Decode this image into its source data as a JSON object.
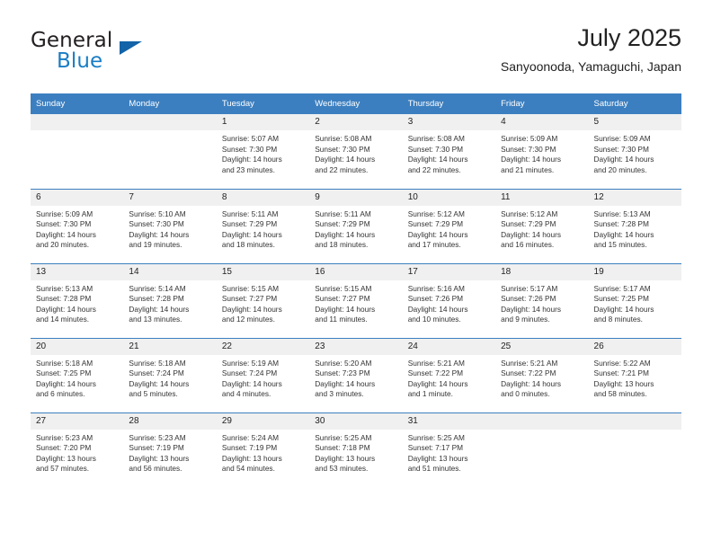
{
  "brand": {
    "name_top": "General",
    "name_bottom": "Blue",
    "accent_color": "#1263a8",
    "text_color": "#231f20",
    "blue_text_color": "#1a7dc4"
  },
  "header": {
    "title": "July 2025",
    "subtitle": "Sanyoonoda, Yamaguchi, Japan"
  },
  "theme": {
    "header_bg": "#3c7fc0",
    "header_text": "#ffffff",
    "daynum_bg": "#f0f0f0",
    "body_text": "#333333"
  },
  "weekdays": [
    "Sunday",
    "Monday",
    "Tuesday",
    "Wednesday",
    "Thursday",
    "Friday",
    "Saturday"
  ],
  "weeks": [
    [
      {
        "day": "",
        "sunrise": "",
        "sunset": "",
        "daylight_1": "",
        "daylight_2": ""
      },
      {
        "day": "",
        "sunrise": "",
        "sunset": "",
        "daylight_1": "",
        "daylight_2": ""
      },
      {
        "day": "1",
        "sunrise": "Sunrise: 5:07 AM",
        "sunset": "Sunset: 7:30 PM",
        "daylight_1": "Daylight: 14 hours",
        "daylight_2": "and 23 minutes."
      },
      {
        "day": "2",
        "sunrise": "Sunrise: 5:08 AM",
        "sunset": "Sunset: 7:30 PM",
        "daylight_1": "Daylight: 14 hours",
        "daylight_2": "and 22 minutes."
      },
      {
        "day": "3",
        "sunrise": "Sunrise: 5:08 AM",
        "sunset": "Sunset: 7:30 PM",
        "daylight_1": "Daylight: 14 hours",
        "daylight_2": "and 22 minutes."
      },
      {
        "day": "4",
        "sunrise": "Sunrise: 5:09 AM",
        "sunset": "Sunset: 7:30 PM",
        "daylight_1": "Daylight: 14 hours",
        "daylight_2": "and 21 minutes."
      },
      {
        "day": "5",
        "sunrise": "Sunrise: 5:09 AM",
        "sunset": "Sunset: 7:30 PM",
        "daylight_1": "Daylight: 14 hours",
        "daylight_2": "and 20 minutes."
      }
    ],
    [
      {
        "day": "6",
        "sunrise": "Sunrise: 5:09 AM",
        "sunset": "Sunset: 7:30 PM",
        "daylight_1": "Daylight: 14 hours",
        "daylight_2": "and 20 minutes."
      },
      {
        "day": "7",
        "sunrise": "Sunrise: 5:10 AM",
        "sunset": "Sunset: 7:30 PM",
        "daylight_1": "Daylight: 14 hours",
        "daylight_2": "and 19 minutes."
      },
      {
        "day": "8",
        "sunrise": "Sunrise: 5:11 AM",
        "sunset": "Sunset: 7:29 PM",
        "daylight_1": "Daylight: 14 hours",
        "daylight_2": "and 18 minutes."
      },
      {
        "day": "9",
        "sunrise": "Sunrise: 5:11 AM",
        "sunset": "Sunset: 7:29 PM",
        "daylight_1": "Daylight: 14 hours",
        "daylight_2": "and 18 minutes."
      },
      {
        "day": "10",
        "sunrise": "Sunrise: 5:12 AM",
        "sunset": "Sunset: 7:29 PM",
        "daylight_1": "Daylight: 14 hours",
        "daylight_2": "and 17 minutes."
      },
      {
        "day": "11",
        "sunrise": "Sunrise: 5:12 AM",
        "sunset": "Sunset: 7:29 PM",
        "daylight_1": "Daylight: 14 hours",
        "daylight_2": "and 16 minutes."
      },
      {
        "day": "12",
        "sunrise": "Sunrise: 5:13 AM",
        "sunset": "Sunset: 7:28 PM",
        "daylight_1": "Daylight: 14 hours",
        "daylight_2": "and 15 minutes."
      }
    ],
    [
      {
        "day": "13",
        "sunrise": "Sunrise: 5:13 AM",
        "sunset": "Sunset: 7:28 PM",
        "daylight_1": "Daylight: 14 hours",
        "daylight_2": "and 14 minutes."
      },
      {
        "day": "14",
        "sunrise": "Sunrise: 5:14 AM",
        "sunset": "Sunset: 7:28 PM",
        "daylight_1": "Daylight: 14 hours",
        "daylight_2": "and 13 minutes."
      },
      {
        "day": "15",
        "sunrise": "Sunrise: 5:15 AM",
        "sunset": "Sunset: 7:27 PM",
        "daylight_1": "Daylight: 14 hours",
        "daylight_2": "and 12 minutes."
      },
      {
        "day": "16",
        "sunrise": "Sunrise: 5:15 AM",
        "sunset": "Sunset: 7:27 PM",
        "daylight_1": "Daylight: 14 hours",
        "daylight_2": "and 11 minutes."
      },
      {
        "day": "17",
        "sunrise": "Sunrise: 5:16 AM",
        "sunset": "Sunset: 7:26 PM",
        "daylight_1": "Daylight: 14 hours",
        "daylight_2": "and 10 minutes."
      },
      {
        "day": "18",
        "sunrise": "Sunrise: 5:17 AM",
        "sunset": "Sunset: 7:26 PM",
        "daylight_1": "Daylight: 14 hours",
        "daylight_2": "and 9 minutes."
      },
      {
        "day": "19",
        "sunrise": "Sunrise: 5:17 AM",
        "sunset": "Sunset: 7:25 PM",
        "daylight_1": "Daylight: 14 hours",
        "daylight_2": "and 8 minutes."
      }
    ],
    [
      {
        "day": "20",
        "sunrise": "Sunrise: 5:18 AM",
        "sunset": "Sunset: 7:25 PM",
        "daylight_1": "Daylight: 14 hours",
        "daylight_2": "and 6 minutes."
      },
      {
        "day": "21",
        "sunrise": "Sunrise: 5:18 AM",
        "sunset": "Sunset: 7:24 PM",
        "daylight_1": "Daylight: 14 hours",
        "daylight_2": "and 5 minutes."
      },
      {
        "day": "22",
        "sunrise": "Sunrise: 5:19 AM",
        "sunset": "Sunset: 7:24 PM",
        "daylight_1": "Daylight: 14 hours",
        "daylight_2": "and 4 minutes."
      },
      {
        "day": "23",
        "sunrise": "Sunrise: 5:20 AM",
        "sunset": "Sunset: 7:23 PM",
        "daylight_1": "Daylight: 14 hours",
        "daylight_2": "and 3 minutes."
      },
      {
        "day": "24",
        "sunrise": "Sunrise: 5:21 AM",
        "sunset": "Sunset: 7:22 PM",
        "daylight_1": "Daylight: 14 hours",
        "daylight_2": "and 1 minute."
      },
      {
        "day": "25",
        "sunrise": "Sunrise: 5:21 AM",
        "sunset": "Sunset: 7:22 PM",
        "daylight_1": "Daylight: 14 hours",
        "daylight_2": "and 0 minutes."
      },
      {
        "day": "26",
        "sunrise": "Sunrise: 5:22 AM",
        "sunset": "Sunset: 7:21 PM",
        "daylight_1": "Daylight: 13 hours",
        "daylight_2": "and 58 minutes."
      }
    ],
    [
      {
        "day": "27",
        "sunrise": "Sunrise: 5:23 AM",
        "sunset": "Sunset: 7:20 PM",
        "daylight_1": "Daylight: 13 hours",
        "daylight_2": "and 57 minutes."
      },
      {
        "day": "28",
        "sunrise": "Sunrise: 5:23 AM",
        "sunset": "Sunset: 7:19 PM",
        "daylight_1": "Daylight: 13 hours",
        "daylight_2": "and 56 minutes."
      },
      {
        "day": "29",
        "sunrise": "Sunrise: 5:24 AM",
        "sunset": "Sunset: 7:19 PM",
        "daylight_1": "Daylight: 13 hours",
        "daylight_2": "and 54 minutes."
      },
      {
        "day": "30",
        "sunrise": "Sunrise: 5:25 AM",
        "sunset": "Sunset: 7:18 PM",
        "daylight_1": "Daylight: 13 hours",
        "daylight_2": "and 53 minutes."
      },
      {
        "day": "31",
        "sunrise": "Sunrise: 5:25 AM",
        "sunset": "Sunset: 7:17 PM",
        "daylight_1": "Daylight: 13 hours",
        "daylight_2": "and 51 minutes."
      },
      {
        "day": "",
        "sunrise": "",
        "sunset": "",
        "daylight_1": "",
        "daylight_2": ""
      },
      {
        "day": "",
        "sunrise": "",
        "sunset": "",
        "daylight_1": "",
        "daylight_2": ""
      }
    ]
  ]
}
